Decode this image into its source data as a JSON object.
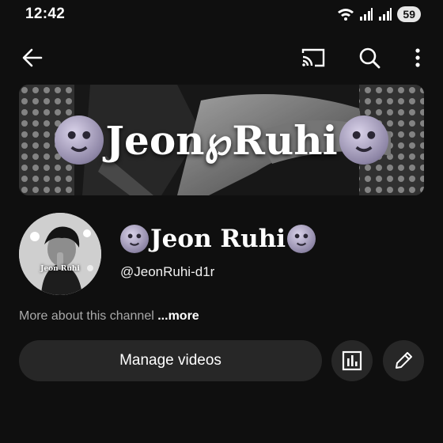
{
  "status_bar": {
    "time": "12:42",
    "battery": "59",
    "icons": [
      "wifi-icon",
      "signal-icon",
      "signal-icon"
    ]
  },
  "app_bar": {
    "icons": [
      "back-arrow-icon",
      "cast-icon",
      "search-icon",
      "more-vert-icon"
    ]
  },
  "banner": {
    "title": "Jeon℘Ruhi"
  },
  "channel": {
    "avatar_label": "Jeon Ruhi",
    "name": "Jeon Ruhi",
    "handle": "@JeonRuhi-d1r",
    "about_text": "More about this channel",
    "about_more": "...more"
  },
  "actions": {
    "manage_videos_label": "Manage videos",
    "icons": [
      "analytics-icon",
      "edit-pencil-icon"
    ]
  },
  "colors": {
    "background": "#0f0f0f",
    "button_bg": "#272727",
    "secondary_text": "#aaaaaa"
  }
}
